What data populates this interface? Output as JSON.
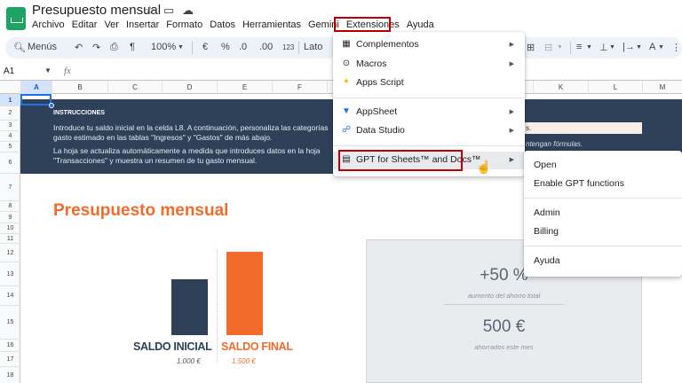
{
  "app": {
    "doc_title": "Presupuesto mensual",
    "title_icons": [
      "star-icon",
      "move-folder-icon",
      "cloud-status-icon"
    ]
  },
  "menubar": [
    "Archivo",
    "Editar",
    "Ver",
    "Insertar",
    "Formato",
    "Datos",
    "Herramientas",
    "Gemini",
    "Extensiones",
    "Ayuda"
  ],
  "toolbar": {
    "search_label": "Menús",
    "zoom": "100%",
    "currency": "€",
    "percent": "%",
    "decrease_decimals": ".0",
    "increase_decimals": ".00",
    "number_format": "123",
    "font": "Lato"
  },
  "formula_bar": {
    "cell_ref": "A1",
    "fx": "fx",
    "content": ""
  },
  "columns": [
    "A",
    "B",
    "C",
    "D",
    "E",
    "F",
    "G",
    "H",
    "I",
    "J",
    "K",
    "L",
    "M"
  ],
  "rows": [
    "1",
    "2",
    "3",
    "4",
    "5",
    "6",
    "7",
    "8",
    "9",
    "10",
    "11",
    "12",
    "13",
    "14",
    "15",
    "16",
    "17",
    "18"
  ],
  "sheet": {
    "instructions_title": "INSTRUCCIONES",
    "instructions": [
      "Introduce tu saldo inicial en la celda L8. A continuación, personaliza las categorías",
      "gasto estimado en las tablas \"Ingresos\" y \"Gastos\" de más abajo.",
      "La hoja se actualiza automáticamente a medida que introduces datos en la hoja",
      "\"Transacciones\" y muestra un resumen de tu gasto mensual."
    ],
    "note_right_1": "s.",
    "note_right_2": "ntengan fórmulas.",
    "budget_title": "Presupuesto mensual",
    "bars": [
      {
        "label": "SALDO INICIAL",
        "value": "1.000 €",
        "amount": 1000,
        "color": "#2e4158"
      },
      {
        "label": "SALDO FINAL",
        "value": "1.500 €",
        "amount": 1500,
        "color": "#f26b2a"
      }
    ],
    "stats": [
      {
        "value": "+50 %",
        "label": "aumento del ahorro total"
      },
      {
        "value": "500 €",
        "label": "ahorrados este mes"
      }
    ]
  },
  "extensions_menu": {
    "items": [
      {
        "label": "Complementos",
        "icon": "addons-icon",
        "submenu": true
      },
      {
        "label": "Macros",
        "icon": "macros-icon",
        "submenu": true
      },
      {
        "label": "Apps Script",
        "icon": "apps-script-icon",
        "submenu": false
      },
      {
        "label": "AppSheet",
        "icon": "appsheet-icon",
        "submenu": true
      },
      {
        "label": "Data Studio",
        "icon": "data-studio-icon",
        "submenu": true
      },
      {
        "label": "GPT for Sheets™ and Docs™",
        "icon": "gpt-addon-icon",
        "submenu": true
      }
    ]
  },
  "gpt_submenu": [
    "Open",
    "Enable GPT functions",
    "Admin",
    "Billing",
    "Ayuda"
  ],
  "colors": {
    "accent": "#f26b2a",
    "navy": "#2e4158",
    "highlight_box": "#c00000",
    "selection": "#1a73e8"
  }
}
